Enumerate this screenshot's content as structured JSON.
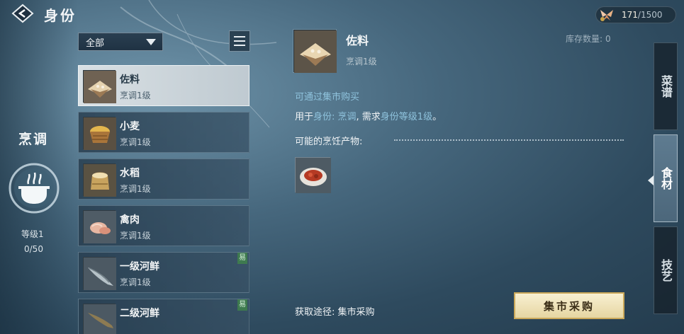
{
  "header": {
    "title": "身份",
    "currency_current": "171",
    "currency_max": "/1500"
  },
  "skill": {
    "name": "烹调",
    "level": "等级1",
    "progress": "0/50"
  },
  "filter": {
    "selected": "全部"
  },
  "items": [
    {
      "name": "佐料",
      "sub": "烹调1级",
      "selected": true,
      "tag": ""
    },
    {
      "name": "小麦",
      "sub": "烹调1级",
      "selected": false,
      "tag": ""
    },
    {
      "name": "水稻",
      "sub": "烹调1级",
      "selected": false,
      "tag": ""
    },
    {
      "name": "禽肉",
      "sub": "烹调1级",
      "selected": false,
      "tag": ""
    },
    {
      "name": "一级河鲜",
      "sub": "烹调1级",
      "selected": false,
      "tag": "易"
    },
    {
      "name": "二级河鲜",
      "sub": "",
      "selected": false,
      "tag": "易"
    }
  ],
  "detail": {
    "name": "佐料",
    "sub": "烹调1级",
    "stock_label": "库存数量:",
    "stock_value": "0",
    "source": "可通过集市购买",
    "usage_prefix": "用于",
    "usage_identity": "身份: 烹调",
    "usage_mid": ", 需求",
    "usage_req": "身份等级1级",
    "usage_end": "。",
    "products_label": "可能的烹饪产物:",
    "obtain": "获取途径: 集市采购",
    "buy_label": "集市采购"
  },
  "tabs": [
    {
      "label": "菜谱",
      "active": false
    },
    {
      "label": "食材",
      "active": true
    },
    {
      "label": "技艺",
      "active": false
    }
  ],
  "colors": {
    "accent_text": "#8fc3dd",
    "buy_button": "#f1e6bf",
    "tag_green": "#3e7a4f"
  }
}
